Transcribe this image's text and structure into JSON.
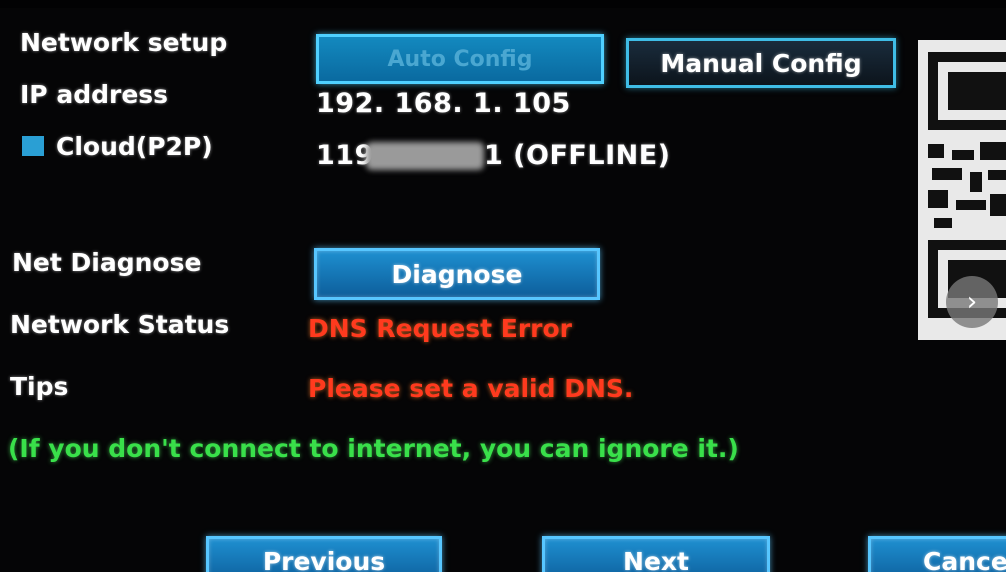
{
  "labels": {
    "network_setup": "Network setup",
    "ip_address": "IP address",
    "cloud": "Cloud(P2P)",
    "net_diagnose": "Net Diagnose",
    "network_status": "Network Status",
    "tips": "Tips"
  },
  "values": {
    "ip_address": "192. 168. 1. 105",
    "cloud_id_prefix": "119",
    "cloud_id_suffix": "1 (OFFLINE)",
    "network_status": "DNS Request Error",
    "tips": "Please set a valid DNS."
  },
  "note": "(If you don't connect to internet, you can ignore it.)",
  "buttons": {
    "auto_config": "Auto Config",
    "manual_config": "Manual Config",
    "diagnose": "Diagnose",
    "previous": "Previous",
    "next": "Next",
    "cancel": "Cancel"
  },
  "overlay": {
    "next_image_icon": "chevron-right-icon"
  },
  "colors": {
    "status_error": "#ff3a1e",
    "note_green": "#39e04a",
    "button_blue": "#1e8fd0"
  }
}
